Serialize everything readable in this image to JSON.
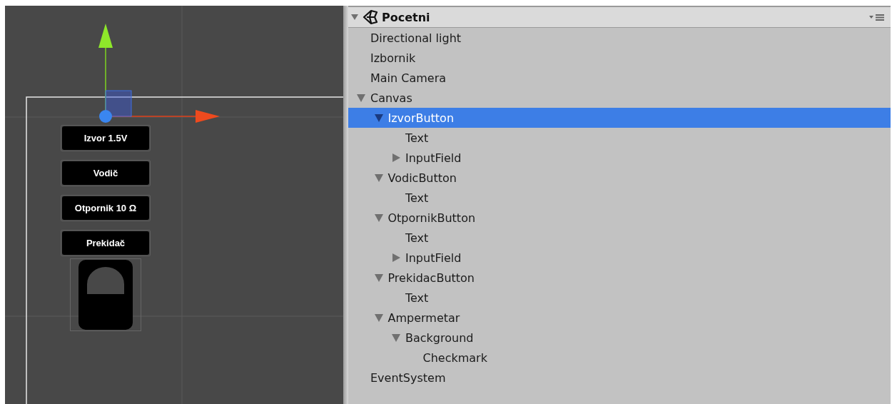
{
  "scene": {
    "buttons": [
      {
        "label": "Izvor 1.5V"
      },
      {
        "label": "Vodič"
      },
      {
        "label": "Otpornik 10 Ω"
      },
      {
        "label": "Prekidač"
      }
    ]
  },
  "hierarchy": {
    "scene_name": "Pocetni",
    "expanded": true,
    "items": [
      {
        "label": "Directional light",
        "selected": false
      },
      {
        "label": "Izbornik",
        "selected": false
      },
      {
        "label": "Main Camera",
        "selected": false
      },
      {
        "label": "Canvas",
        "selected": false,
        "expanded": true,
        "children": [
          {
            "label": "IzvorButton",
            "selected": true,
            "expanded": true,
            "children": [
              {
                "label": "Text",
                "selected": false
              },
              {
                "label": "InputField",
                "selected": false,
                "expanded": false
              }
            ]
          },
          {
            "label": "VodicButton",
            "selected": false,
            "expanded": true,
            "children": [
              {
                "label": "Text",
                "selected": false
              }
            ]
          },
          {
            "label": "OtpornikButton",
            "selected": false,
            "expanded": true,
            "children": [
              {
                "label": "Text",
                "selected": false
              },
              {
                "label": "InputField",
                "selected": false,
                "expanded": false
              }
            ]
          },
          {
            "label": "PrekidacButton",
            "selected": false,
            "expanded": true,
            "children": [
              {
                "label": "Text",
                "selected": false
              }
            ]
          },
          {
            "label": "Ampermetar",
            "selected": false,
            "expanded": true,
            "children": [
              {
                "label": "Background",
                "selected": false,
                "expanded": true,
                "children": [
                  {
                    "label": "Checkmark",
                    "selected": false
                  }
                ]
              }
            ]
          }
        ]
      },
      {
        "label": "EventSystem",
        "selected": false
      }
    ]
  }
}
